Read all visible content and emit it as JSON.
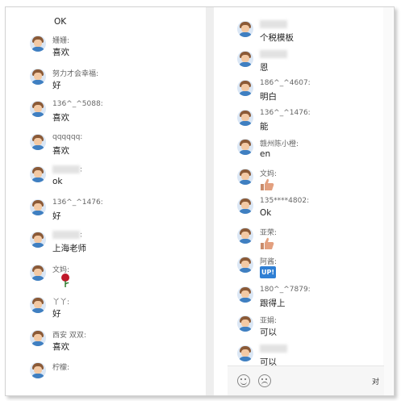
{
  "left_top_text": "OK",
  "left_messages": [
    {
      "name": "姗姗:",
      "text": "喜欢",
      "type": "text"
    },
    {
      "name": "努力才会幸福:",
      "text": "好",
      "type": "text"
    },
    {
      "name": "136^_^5088:",
      "text": "喜欢",
      "type": "text"
    },
    {
      "name": "qqqqqq:",
      "text": "喜欢",
      "type": "text"
    },
    {
      "name": ":",
      "text": "ok",
      "type": "blurred-name"
    },
    {
      "name": "136^_^1476:",
      "text": "好",
      "type": "text"
    },
    {
      "name": ":",
      "text": "上海老师",
      "type": "blurred-name"
    },
    {
      "name": "文妈:",
      "text": "",
      "type": "rose"
    },
    {
      "name": "丫丫:",
      "text": "好",
      "type": "text"
    },
    {
      "name": "西安 双双:",
      "text": "喜欢",
      "type": "text"
    },
    {
      "name": "柠檬:",
      "text": "",
      "type": "text"
    }
  ],
  "right_messages": [
    {
      "name": "",
      "text": "个税模板",
      "type": "blurred-name"
    },
    {
      "name": "",
      "text": "恩",
      "type": "blurred-name"
    },
    {
      "name": "186^_^4607:",
      "text": "明白",
      "type": "text"
    },
    {
      "name": "136^_^1476:",
      "text": "能",
      "type": "text"
    },
    {
      "name": "赣州陈小橙:",
      "text": "en",
      "type": "text"
    },
    {
      "name": "文妈:",
      "text": "",
      "type": "thumb"
    },
    {
      "name": "135****4802:",
      "text": "Ok",
      "type": "text"
    },
    {
      "name": "亚荣:",
      "text": "",
      "type": "thumb"
    },
    {
      "name": "阿酱:",
      "text": "UP!",
      "type": "up"
    },
    {
      "name": "180^_^7879:",
      "text": "跟得上",
      "type": "text"
    },
    {
      "name": "亚娟:",
      "text": "可以",
      "type": "text"
    },
    {
      "name": "",
      "text": "可以",
      "type": "blurred-name"
    }
  ],
  "footer": {
    "send_label": "对"
  },
  "icons": {
    "emoji": "smiley-icon",
    "sticker": "emoticon-icon"
  }
}
